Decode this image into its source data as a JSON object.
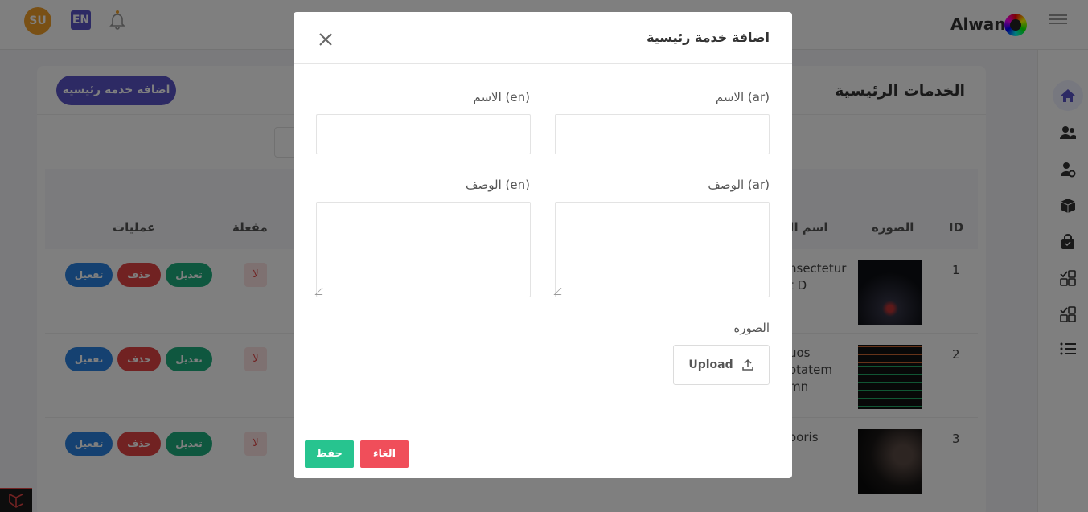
{
  "header": {
    "user_initials": "SU",
    "language": "EN",
    "brand": "Alwan"
  },
  "page": {
    "title": "الخدمات الرئيسية",
    "add_button": "اضافة خدمة رئيسية"
  },
  "table": {
    "columns": {
      "id": "ID",
      "image": "الصوره",
      "name": "اسم الخ",
      "active": "مفعلة",
      "actions": "عمليات"
    },
    "rows": [
      {
        "id": "1",
        "name_line1": "nsectetur",
        "name_line2": "t D",
        "name_line3": "",
        "active": "لا"
      },
      {
        "id": "2",
        "name_line1": "uos",
        "name_line2": "otatem",
        "name_line3": "mn",
        "active": "لا"
      },
      {
        "id": "3",
        "name_line1": "ooris",
        "name_line2": "",
        "name_line3": "",
        "active": "لا"
      }
    ],
    "actions": {
      "edit": "تعديل",
      "delete": "حذف",
      "activate": "تفعيل"
    }
  },
  "modal": {
    "title": "اضافة خدمة رئيسية",
    "name_ar_label": "الاسم (ar)",
    "name_en_label": "الاسم (en)",
    "desc_ar_label": "الوصف (ar)",
    "desc_en_label": "الوصف (en)",
    "image_label": "الصوره",
    "upload_label": "Upload",
    "save": "حفظ",
    "cancel": "الغاء"
  },
  "colors": {
    "primary": "#5b55c9",
    "save": "#27c48f",
    "cancel": "#f04e5a",
    "edit": "#1fae7f",
    "delete": "#e24545",
    "activate": "#2b83e2"
  },
  "icons": [
    "bell-icon",
    "close-icon",
    "upload-icon",
    "home-icon",
    "users-icon",
    "user-settings-icon",
    "box-icon",
    "bag-icon",
    "checklist-icon",
    "list-icon",
    "menu-icon"
  ]
}
